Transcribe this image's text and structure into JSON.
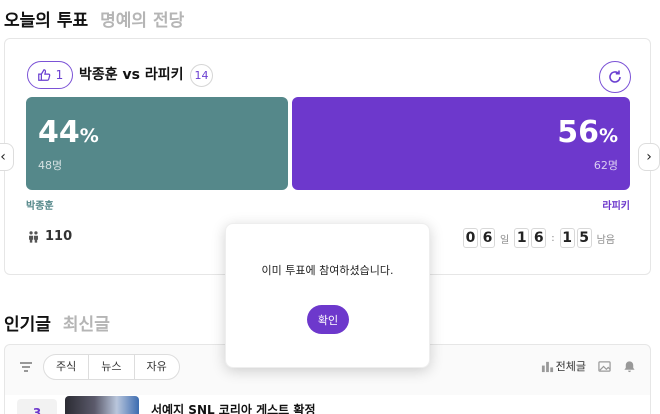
{
  "top_tabs": {
    "today_vote": "오늘의 투표",
    "hall_of_fame": "명예의 전당"
  },
  "vote": {
    "like_count": "1",
    "title": "박종훈 vs 라피키",
    "comment_count": "14",
    "left": {
      "name": "박종훈",
      "percent": "44",
      "votes": "48명",
      "color": "#55888a"
    },
    "right": {
      "name": "라피키",
      "percent": "56",
      "votes": "62명",
      "color": "#6d38cc"
    },
    "percent_unit": "%",
    "participants": "110",
    "timer": {
      "day_digits": [
        "0",
        "6"
      ],
      "day_unit": "일",
      "hour_digits": [
        "1",
        "6"
      ],
      "min_digits": [
        "1",
        "5"
      ],
      "remaining_label": "남음"
    }
  },
  "dialog": {
    "message": "이미 투표에 참여하셨습니다.",
    "confirm_label": "확인"
  },
  "section_tabs": {
    "popular": "인기글",
    "latest": "최신글"
  },
  "filters": {
    "items": [
      "주식",
      "뉴스",
      "자유"
    ],
    "all_label": "전체글"
  },
  "posts": [
    {
      "rank": "3",
      "title": "서예지 SNL 코리아 게스트 확정"
    }
  ],
  "colors": {
    "accent": "#6d38cc",
    "teal": "#55888a"
  }
}
